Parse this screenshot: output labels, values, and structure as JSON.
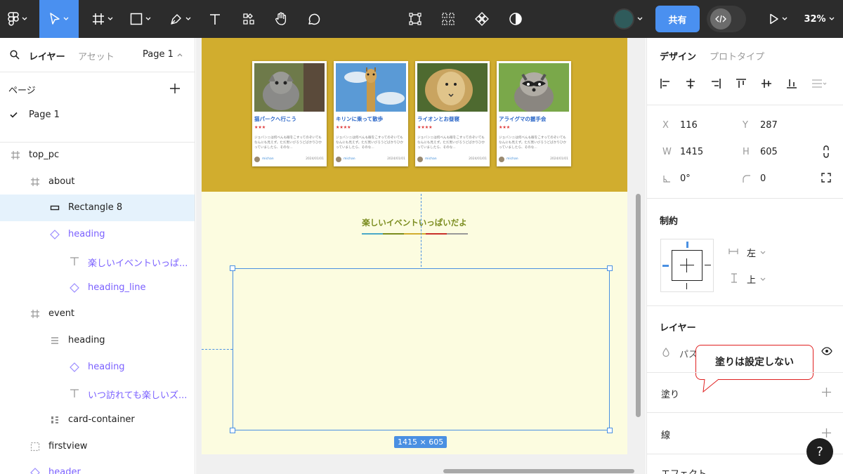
{
  "toolbar": {
    "zoom": "32%",
    "share_label": "共有",
    "colors": {
      "bg": "#2c2c2c",
      "active_tool": "#4a90f0",
      "share": "#4a90f0",
      "avatar": "#2f5b5b"
    }
  },
  "left_panel": {
    "tabs": {
      "layers": "レイヤー",
      "assets": "アセット"
    },
    "page_selector": "Page 1",
    "pages_heading": "ページ",
    "pages": [
      "Page 1"
    ],
    "layers": [
      {
        "label": "top_pc",
        "icon": "frame-icon",
        "depth": 0
      },
      {
        "label": "about",
        "icon": "frame-icon",
        "depth": 1
      },
      {
        "label": "Rectangle 8",
        "icon": "rectangle-icon",
        "depth": 2,
        "selected": true
      },
      {
        "label": "heading",
        "icon": "component-instance-icon",
        "depth": 2
      },
      {
        "label": "楽しいイベントいっぱ...",
        "icon": "text-icon",
        "depth": 3
      },
      {
        "label": "heading_line",
        "icon": "component-instance-icon",
        "depth": 3
      },
      {
        "label": "event",
        "icon": "frame-icon",
        "depth": 1
      },
      {
        "label": "heading",
        "icon": "autolayout-icon",
        "depth": 2
      },
      {
        "label": "heading",
        "icon": "component-instance-icon",
        "depth": 3
      },
      {
        "label": "いつ訪れても楽しいズ...",
        "icon": "text-icon",
        "depth": 3
      },
      {
        "label": "card-container",
        "icon": "grid-icon",
        "depth": 2
      },
      {
        "label": "firstview",
        "icon": "dashed-frame-icon",
        "depth": 1
      },
      {
        "label": "header",
        "icon": "component-instance-icon",
        "depth": 1
      }
    ]
  },
  "canvas": {
    "cards": [
      {
        "title": "猫パークへ行こう",
        "stars": "★★★",
        "text": "ジョバンニは何べんも眼をこすってのぞいてもなんにも見えず。ただ黒いびろうどばかりひかっていましたら、そのな...",
        "author": "michan",
        "date": "2024/01/01"
      },
      {
        "title": "キリンに乗って散歩",
        "stars": "★★★★",
        "text": "ジョバンニは何べんも眼をこすってのぞいてもなんにも見えず。ただ黒いびろうどばかりひかっていましたら、そのな...",
        "author": "michan",
        "date": "2024/01/01"
      },
      {
        "title": "ライオンとお昼寝",
        "stars": "★★★★",
        "text": "ジョバンニは何べんも眼をこすってのぞいてもなんにも見えず。ただ黒いびろうどばかりひかっていましたら、そのな...",
        "author": "michan",
        "date": "2024/01/01"
      },
      {
        "title": "アライグマの握手会",
        "stars": "★★★",
        "text": "ジョバンニは何べんも眼をこすってのぞいてもなんにも見えず。ただ黒いびろうどばかりひかっていましたら、そのな...",
        "author": "michan",
        "date": "2024/01/01"
      }
    ],
    "about_heading": "楽しいイベントいっぱいだよ",
    "size_label": "1415 × 605",
    "colors": {
      "event_bg": "#d1ad2e",
      "about_bg": "#fcfce0",
      "heading": "#7a8c1e",
      "selection": "#4a90e2"
    }
  },
  "right_panel": {
    "tabs": {
      "design": "デザイン",
      "prototype": "プロトタイプ"
    },
    "x_label": "X",
    "x": "116",
    "y_label": "Y",
    "y": "287",
    "w_label": "W",
    "w": "1415",
    "h_label": "H",
    "h": "605",
    "rotation": "0°",
    "radius": "0",
    "constraints_heading": "制約",
    "constraint_h": "左",
    "constraint_v": "上",
    "layer_heading": "レイヤー",
    "layer_mode": "パス",
    "fill_heading": "塗り",
    "stroke_heading": "線",
    "effects_heading": "エフェクト",
    "callout": "塗りは設定しない",
    "help": "?"
  }
}
